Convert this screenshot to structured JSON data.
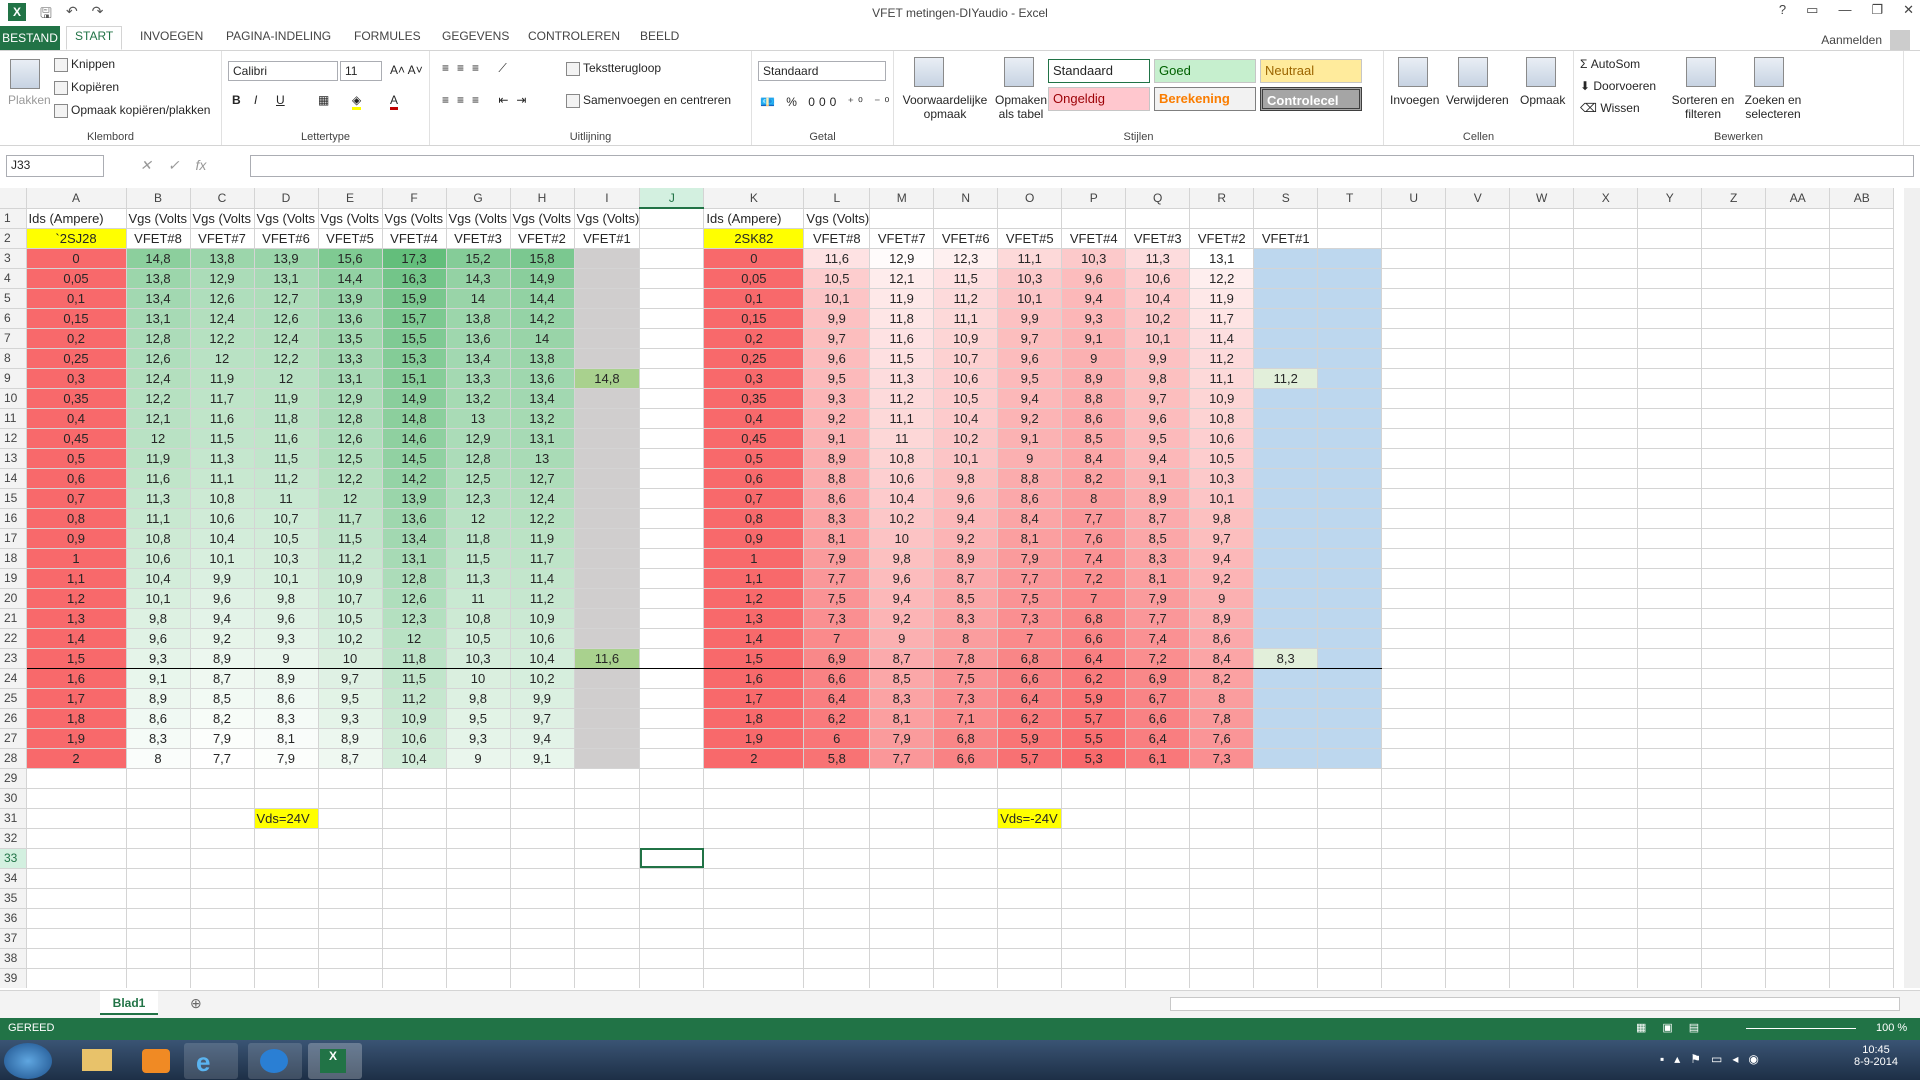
{
  "window": {
    "title": "VFET metingen-DIYaudio - Excel",
    "signin": "Aanmelden"
  },
  "tabs": [
    "BESTAND",
    "START",
    "INVOEGEN",
    "PAGINA-INDELING",
    "FORMULES",
    "GEGEVENS",
    "CONTROLEREN",
    "BEELD"
  ],
  "ribbon": {
    "clipboard": {
      "label": "Klembord",
      "paste": "Plakken",
      "cut": "Knippen",
      "copy": "Kopiëren",
      "painter": "Opmaak kopiëren/plakken"
    },
    "font": {
      "label": "Lettertype",
      "name": "Calibri",
      "size": "11"
    },
    "align": {
      "label": "Uitlijning",
      "wrap": "Tekstterugloop",
      "merge": "Samenvoegen en centreren"
    },
    "number": {
      "label": "Getal",
      "format": "Standaard"
    },
    "styles": {
      "label": "Stijlen",
      "cond": "Voorwaardelijke opmaak",
      "table": "Opmaken als tabel",
      "s1": "Standaard",
      "s2": "Goed",
      "s3": "Neutraal",
      "s4": "Ongeldig",
      "s5": "Berekening",
      "s6": "Controlecel"
    },
    "cells": {
      "label": "Cellen",
      "insert": "Invoegen",
      "delete": "Verwijderen",
      "format": "Opmaak"
    },
    "edit": {
      "label": "Bewerken",
      "autosum": "AutoSom",
      "fill": "Doorvoeren",
      "clear": "Wissen",
      "sort": "Sorteren en filteren",
      "find": "Zoeken en selecteren"
    }
  },
  "namebox": "J33",
  "columns": [
    "A",
    "B",
    "C",
    "D",
    "E",
    "F",
    "G",
    "H",
    "I",
    "J",
    "K",
    "L",
    "M",
    "N",
    "O",
    "P",
    "Q",
    "R",
    "S",
    "T",
    "U",
    "V",
    "W",
    "X",
    "Y",
    "Z",
    "AA",
    "AB"
  ],
  "rows": [
    [
      "Ids (Ampere)",
      "Vgs (Volts",
      "Vgs (Volts",
      "Vgs (Volts",
      "Vgs (Volts",
      "Vgs (Volts",
      "Vgs (Volts",
      "Vgs (Volts",
      "Vgs (Volts)",
      "",
      "Ids (Ampere)",
      "Vgs (Volts)",
      "",
      "",
      "",
      "",
      "",
      "",
      "",
      ""
    ],
    [
      "`2SJ28",
      "VFET#8",
      "VFET#7",
      "VFET#6",
      "VFET#5",
      "VFET#4",
      "VFET#3",
      "VFET#2",
      "VFET#1",
      "",
      "2SK82",
      "VFET#8",
      "VFET#7",
      "VFET#6",
      "VFET#5",
      "VFET#4",
      "VFET#3",
      "VFET#2",
      "VFET#1",
      ""
    ],
    [
      "0",
      "14,8",
      "13,8",
      "13,9",
      "15,6",
      "17,3",
      "15,2",
      "15,8",
      "",
      "",
      "0",
      "11,6",
      "12,9",
      "12,3",
      "11,1",
      "10,3",
      "11,3",
      "13,1",
      "",
      ""
    ],
    [
      "0,05",
      "13,8",
      "12,9",
      "13,1",
      "14,4",
      "16,3",
      "14,3",
      "14,9",
      "",
      "",
      "0,05",
      "10,5",
      "12,1",
      "11,5",
      "10,3",
      "9,6",
      "10,6",
      "12,2",
      "",
      ""
    ],
    [
      "0,1",
      "13,4",
      "12,6",
      "12,7",
      "13,9",
      "15,9",
      "14",
      "14,4",
      "",
      "",
      "0,1",
      "10,1",
      "11,9",
      "11,2",
      "10,1",
      "9,4",
      "10,4",
      "11,9",
      "",
      ""
    ],
    [
      "0,15",
      "13,1",
      "12,4",
      "12,6",
      "13,6",
      "15,7",
      "13,8",
      "14,2",
      "",
      "",
      "0,15",
      "9,9",
      "11,8",
      "11,1",
      "9,9",
      "9,3",
      "10,2",
      "11,7",
      "",
      ""
    ],
    [
      "0,2",
      "12,8",
      "12,2",
      "12,4",
      "13,5",
      "15,5",
      "13,6",
      "14",
      "",
      "",
      "0,2",
      "9,7",
      "11,6",
      "10,9",
      "9,7",
      "9,1",
      "10,1",
      "11,4",
      "",
      ""
    ],
    [
      "0,25",
      "12,6",
      "12",
      "12,2",
      "13,3",
      "15,3",
      "13,4",
      "13,8",
      "",
      "",
      "0,25",
      "9,6",
      "11,5",
      "10,7",
      "9,6",
      "9",
      "9,9",
      "11,2",
      "",
      ""
    ],
    [
      "0,3",
      "12,4",
      "11,9",
      "12",
      "13,1",
      "15,1",
      "13,3",
      "13,6",
      "14,8",
      "",
      "0,3",
      "9,5",
      "11,3",
      "10,6",
      "9,5",
      "8,9",
      "9,8",
      "11,1",
      "11,2",
      ""
    ],
    [
      "0,35",
      "12,2",
      "11,7",
      "11,9",
      "12,9",
      "14,9",
      "13,2",
      "13,4",
      "",
      "",
      "0,35",
      "9,3",
      "11,2",
      "10,5",
      "9,4",
      "8,8",
      "9,7",
      "10,9",
      "",
      ""
    ],
    [
      "0,4",
      "12,1",
      "11,6",
      "11,8",
      "12,8",
      "14,8",
      "13",
      "13,2",
      "",
      "",
      "0,4",
      "9,2",
      "11,1",
      "10,4",
      "9,2",
      "8,6",
      "9,6",
      "10,8",
      "",
      ""
    ],
    [
      "0,45",
      "12",
      "11,5",
      "11,6",
      "12,6",
      "14,6",
      "12,9",
      "13,1",
      "",
      "",
      "0,45",
      "9,1",
      "11",
      "10,2",
      "9,1",
      "8,5",
      "9,5",
      "10,6",
      "",
      ""
    ],
    [
      "0,5",
      "11,9",
      "11,3",
      "11,5",
      "12,5",
      "14,5",
      "12,8",
      "13",
      "",
      "",
      "0,5",
      "8,9",
      "10,8",
      "10,1",
      "9",
      "8,4",
      "9,4",
      "10,5",
      "",
      ""
    ],
    [
      "0,6",
      "11,6",
      "11,1",
      "11,2",
      "12,2",
      "14,2",
      "12,5",
      "12,7",
      "",
      "",
      "0,6",
      "8,8",
      "10,6",
      "9,8",
      "8,8",
      "8,2",
      "9,1",
      "10,3",
      "",
      ""
    ],
    [
      "0,7",
      "11,3",
      "10,8",
      "11",
      "12",
      "13,9",
      "12,3",
      "12,4",
      "",
      "",
      "0,7",
      "8,6",
      "10,4",
      "9,6",
      "8,6",
      "8",
      "8,9",
      "10,1",
      "",
      ""
    ],
    [
      "0,8",
      "11,1",
      "10,6",
      "10,7",
      "11,7",
      "13,6",
      "12",
      "12,2",
      "",
      "",
      "0,8",
      "8,3",
      "10,2",
      "9,4",
      "8,4",
      "7,7",
      "8,7",
      "9,8",
      "",
      ""
    ],
    [
      "0,9",
      "10,8",
      "10,4",
      "10,5",
      "11,5",
      "13,4",
      "11,8",
      "11,9",
      "",
      "",
      "0,9",
      "8,1",
      "10",
      "9,2",
      "8,1",
      "7,6",
      "8,5",
      "9,7",
      "",
      ""
    ],
    [
      "1",
      "10,6",
      "10,1",
      "10,3",
      "11,2",
      "13,1",
      "11,5",
      "11,7",
      "",
      "",
      "1",
      "7,9",
      "9,8",
      "8,9",
      "7,9",
      "7,4",
      "8,3",
      "9,4",
      "",
      ""
    ],
    [
      "1,1",
      "10,4",
      "9,9",
      "10,1",
      "10,9",
      "12,8",
      "11,3",
      "11,4",
      "",
      "",
      "1,1",
      "7,7",
      "9,6",
      "8,7",
      "7,7",
      "7,2",
      "8,1",
      "9,2",
      "",
      ""
    ],
    [
      "1,2",
      "10,1",
      "9,6",
      "9,8",
      "10,7",
      "12,6",
      "11",
      "11,2",
      "",
      "",
      "1,2",
      "7,5",
      "9,4",
      "8,5",
      "7,5",
      "7",
      "7,9",
      "9",
      "",
      ""
    ],
    [
      "1,3",
      "9,8",
      "9,4",
      "9,6",
      "10,5",
      "12,3",
      "10,8",
      "10,9",
      "",
      "",
      "1,3",
      "7,3",
      "9,2",
      "8,3",
      "7,3",
      "6,8",
      "7,7",
      "8,9",
      "",
      ""
    ],
    [
      "1,4",
      "9,6",
      "9,2",
      "9,3",
      "10,2",
      "12",
      "10,5",
      "10,6",
      "",
      "",
      "1,4",
      "7",
      "9",
      "8",
      "7",
      "6,6",
      "7,4",
      "8,6",
      "",
      ""
    ],
    [
      "1,5",
      "9,3",
      "8,9",
      "9",
      "10",
      "11,8",
      "10,3",
      "10,4",
      "11,6",
      "",
      "1,5",
      "6,9",
      "8,7",
      "7,8",
      "6,8",
      "6,4",
      "7,2",
      "8,4",
      "8,3",
      ""
    ],
    [
      "1,6",
      "9,1",
      "8,7",
      "8,9",
      "9,7",
      "11,5",
      "10",
      "10,2",
      "",
      "",
      "1,6",
      "6,6",
      "8,5",
      "7,5",
      "6,6",
      "6,2",
      "6,9",
      "8,2",
      "",
      ""
    ],
    [
      "1,7",
      "8,9",
      "8,5",
      "8,6",
      "9,5",
      "11,2",
      "9,8",
      "9,9",
      "",
      "",
      "1,7",
      "6,4",
      "8,3",
      "7,3",
      "6,4",
      "5,9",
      "6,7",
      "8",
      "",
      ""
    ],
    [
      "1,8",
      "8,6",
      "8,2",
      "8,3",
      "9,3",
      "10,9",
      "9,5",
      "9,7",
      "",
      "",
      "1,8",
      "6,2",
      "8,1",
      "7,1",
      "6,2",
      "5,7",
      "6,6",
      "7,8",
      "",
      ""
    ],
    [
      "1,9",
      "8,3",
      "7,9",
      "8,1",
      "8,9",
      "10,6",
      "9,3",
      "9,4",
      "",
      "",
      "1,9",
      "6",
      "7,9",
      "6,8",
      "5,9",
      "5,5",
      "6,4",
      "7,6",
      "",
      ""
    ],
    [
      "2",
      "8",
      "7,7",
      "7,9",
      "8,7",
      "10,4",
      "9",
      "9,1",
      "",
      "",
      "2",
      "5,8",
      "7,7",
      "6,6",
      "5,7",
      "5,3",
      "6,1",
      "7,3",
      "",
      ""
    ]
  ],
  "notes": {
    "left": "Vds=24V",
    "right": "Vds=-24V"
  },
  "sheet": "Blad1",
  "status": {
    "ready": "GEREED",
    "zoom": "100 %"
  },
  "clock": {
    "time": "10:45",
    "date": "8-9-2014"
  }
}
